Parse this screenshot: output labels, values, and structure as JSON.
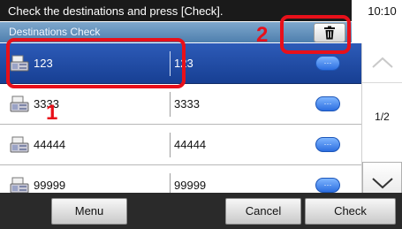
{
  "header": {
    "message": "Check the destinations and press [Check].",
    "time": "10:10",
    "title": "Destinations Check"
  },
  "icons": {
    "delete": "trash-icon",
    "fax": "fax-machine-icon",
    "detail": "ellipsis-icon",
    "scroll_up": "chevron-up-icon",
    "scroll_down": "chevron-down-icon"
  },
  "destinations": [
    {
      "name": "123",
      "number": "123",
      "selected": true
    },
    {
      "name": "3333",
      "number": "3333",
      "selected": false
    },
    {
      "name": "44444",
      "number": "44444",
      "selected": false
    },
    {
      "name": "99999",
      "number": "99999",
      "selected": false
    }
  ],
  "detail_label": "···",
  "pagination": {
    "indicator": "1/2"
  },
  "footer": {
    "menu": "Menu",
    "cancel": "Cancel",
    "check": "Check"
  },
  "callouts": [
    "1",
    "2"
  ],
  "colors": {
    "callout": "#e8101a",
    "selected_row": "#1f4aa3",
    "title_bar": "#5f8cb8"
  }
}
